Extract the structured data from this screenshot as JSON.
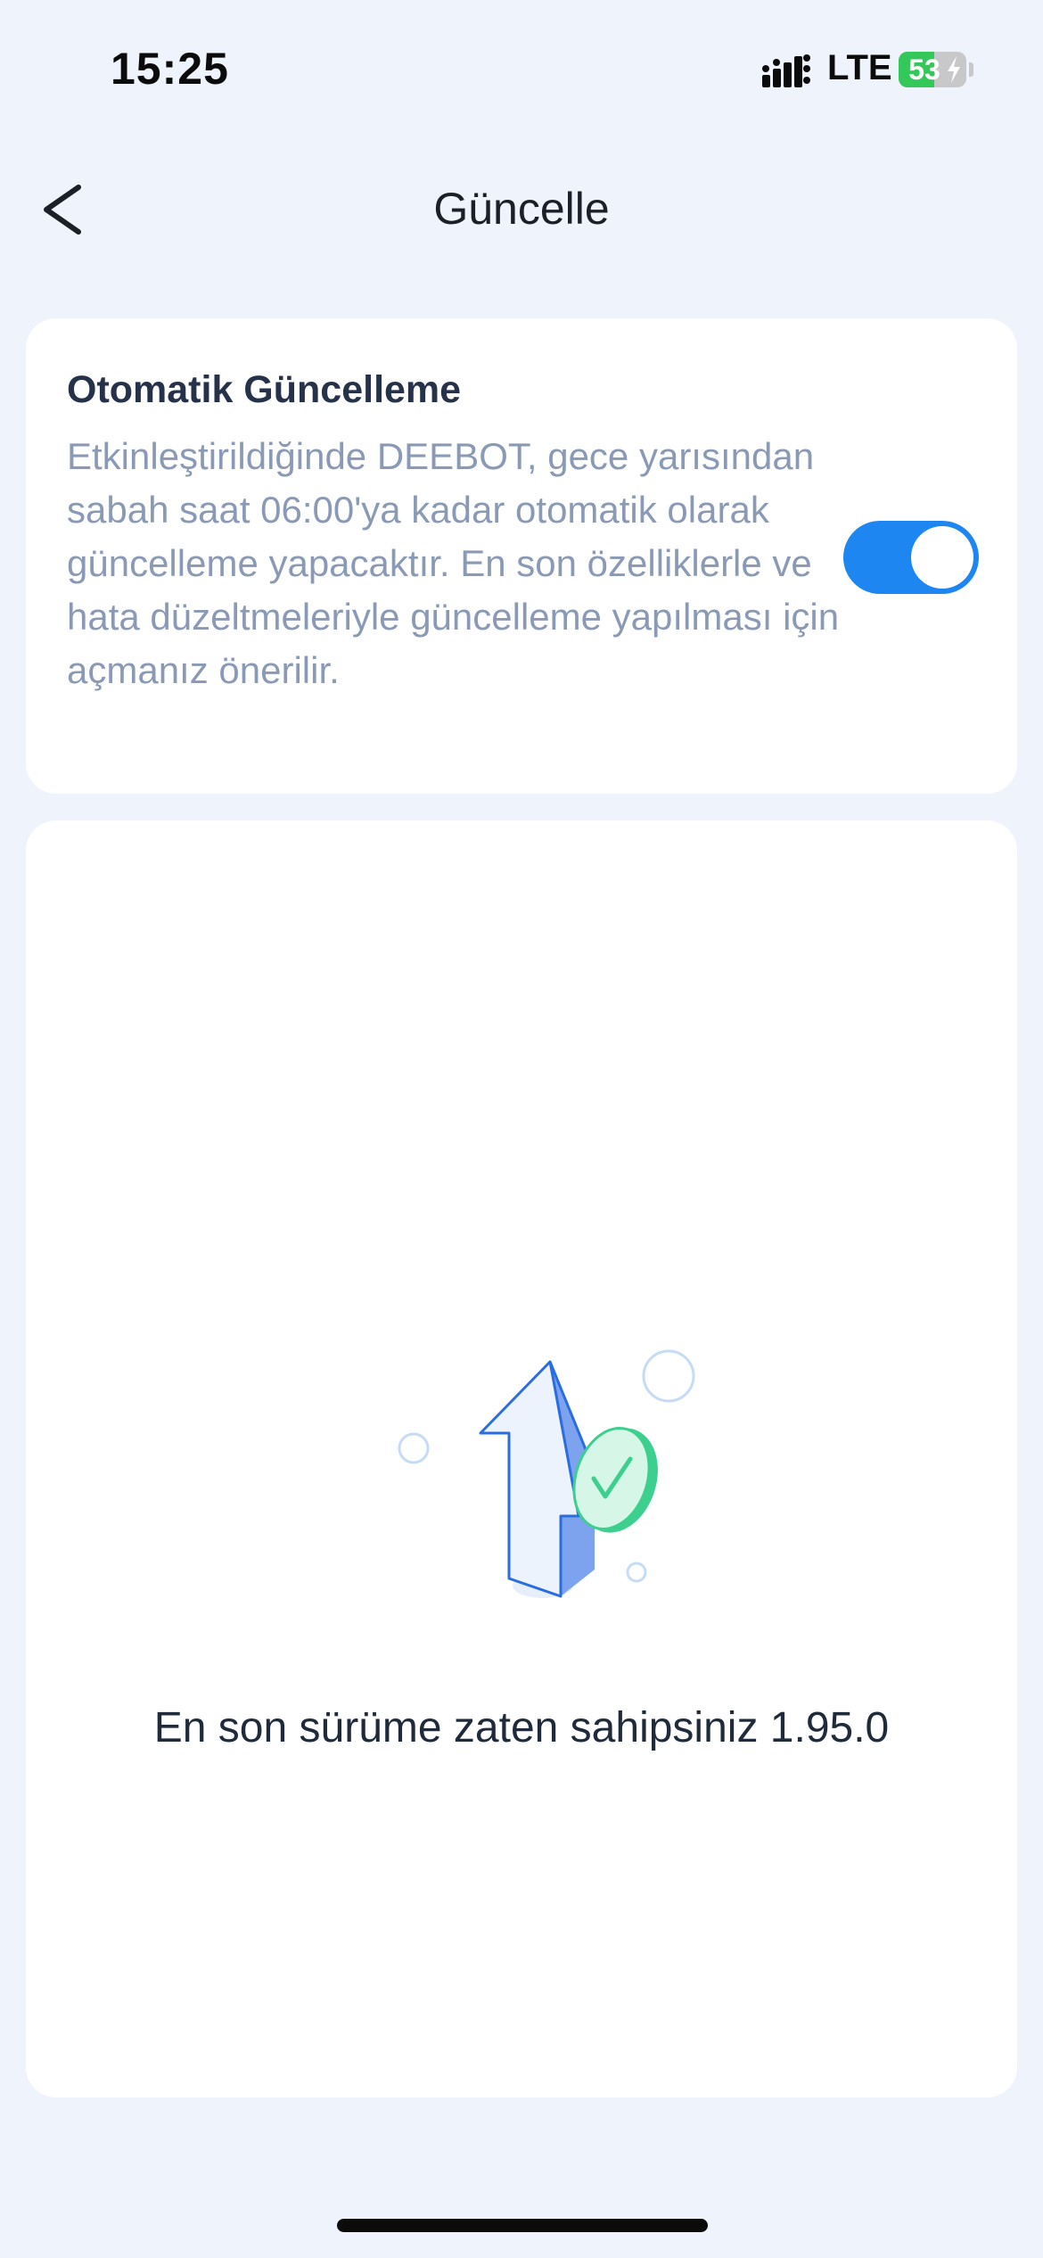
{
  "status_bar": {
    "time": "15:25",
    "network": "LTE",
    "battery_percent": "53",
    "battery_level": 0.53,
    "battery_color": "#34c759"
  },
  "header": {
    "title": "Güncelle",
    "back_icon": "chevron-left-icon"
  },
  "auto_update": {
    "title": "Otomatik Güncelleme",
    "description": "Etkinleştirildiğinde DEEBOT, gece yarısından sabah saat 06:00'ya kadar otomatik olarak güncelleme yapacaktır. En son özelliklerle ve hata düzeltmeleriyle güncelleme yapılması için açmanız önerilir.",
    "enabled": true,
    "toggle_color": "#1e86f0"
  },
  "status": {
    "illustration_icon": "upload-arrow-check-icon",
    "message": "En son sürüme zaten sahipsiniz 1.95.0"
  },
  "colors": {
    "background": "#eff4fc",
    "card": "#ffffff",
    "accent": "#1e86f0",
    "check_green": "#3ccf8e"
  }
}
